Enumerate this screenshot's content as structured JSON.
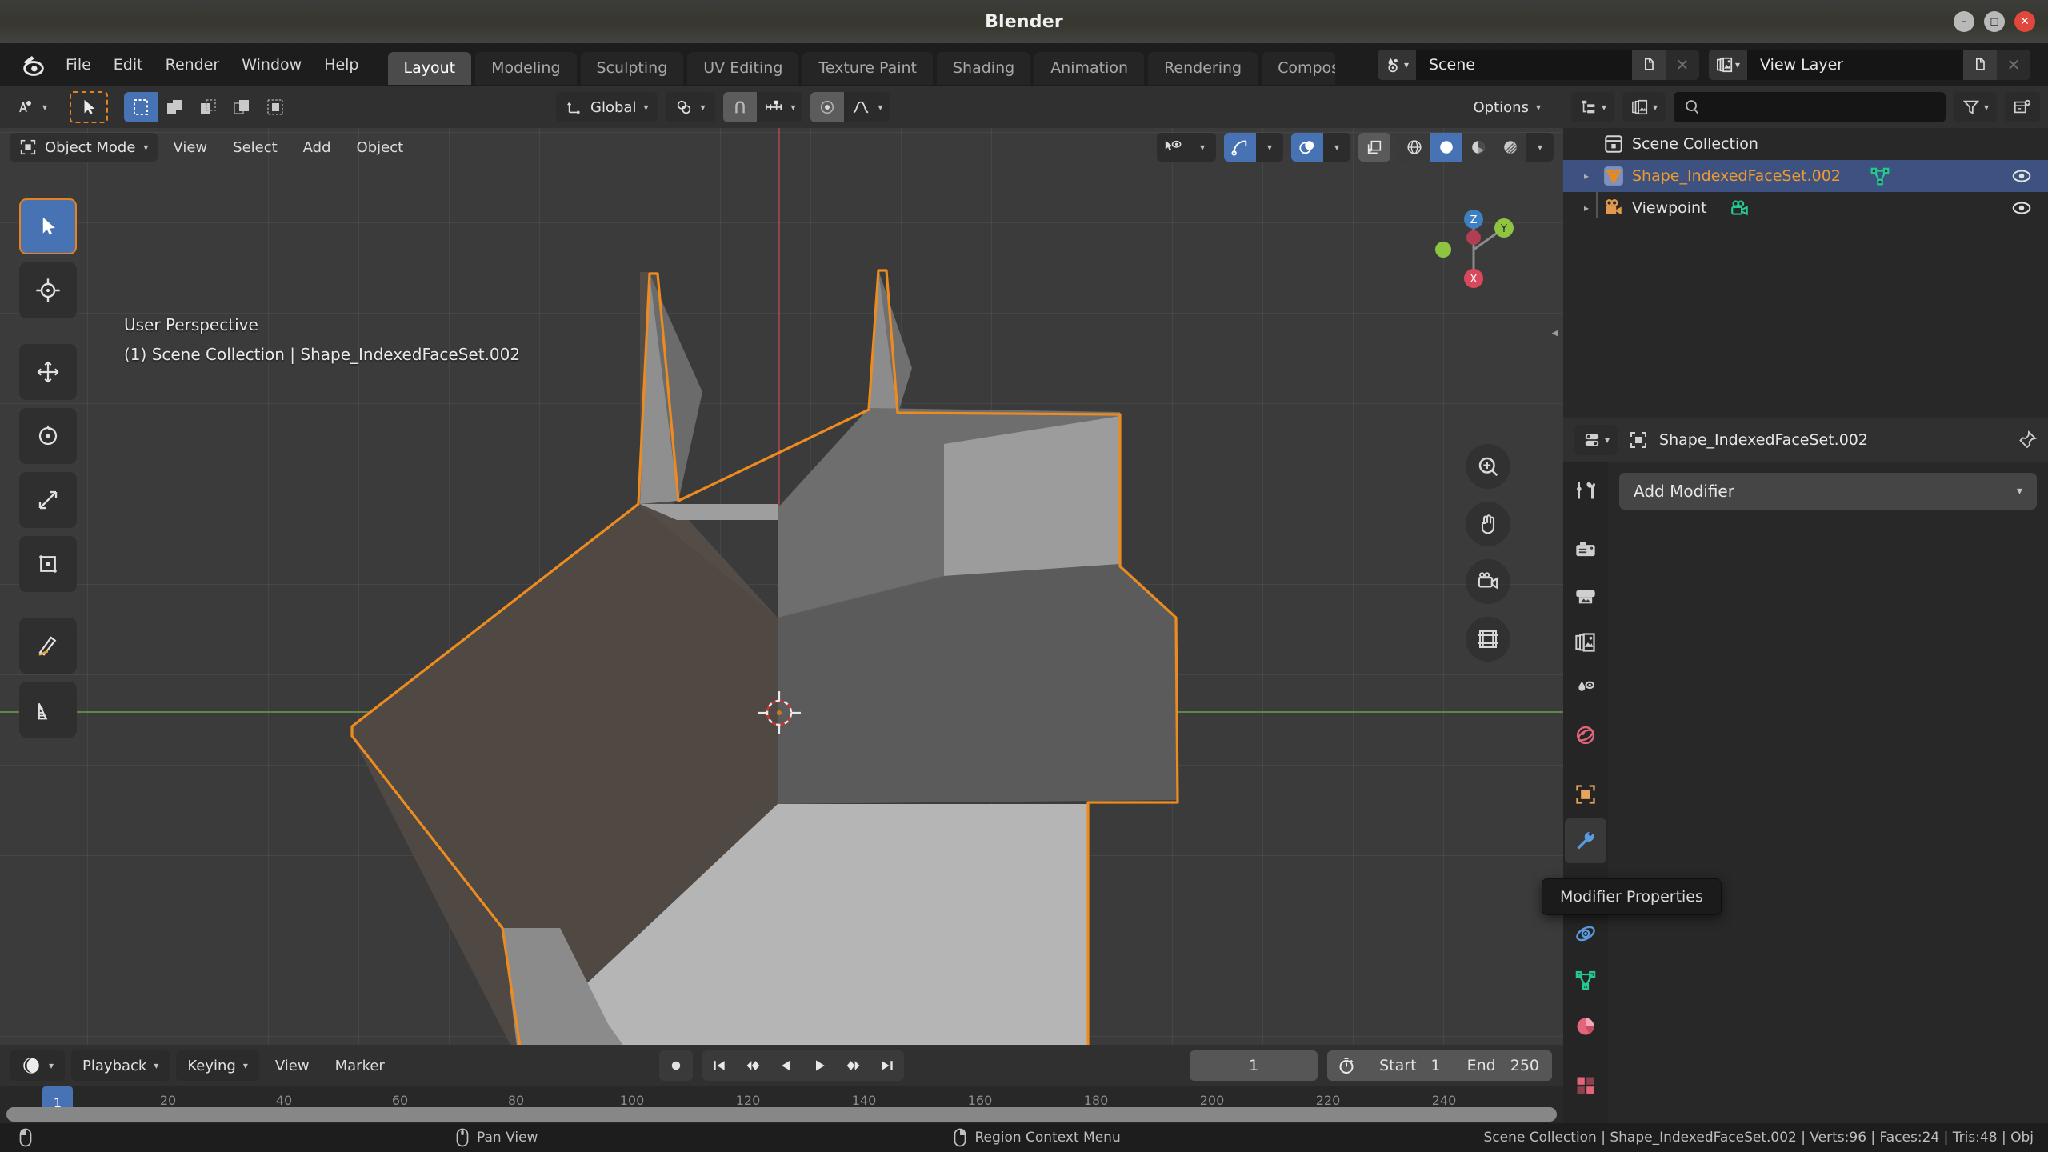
{
  "window": {
    "title": "Blender",
    "controls": {
      "minimize": "minimize-icon",
      "maximize": "maximize-icon",
      "close": "close-icon"
    }
  },
  "topbar": {
    "logo": "blender-logo-icon",
    "menus": [
      "File",
      "Edit",
      "Render",
      "Window",
      "Help"
    ],
    "workspaces": [
      {
        "label": "Layout",
        "active": true
      },
      {
        "label": "Modeling",
        "active": false
      },
      {
        "label": "Sculpting",
        "active": false
      },
      {
        "label": "UV Editing",
        "active": false
      },
      {
        "label": "Texture Paint",
        "active": false
      },
      {
        "label": "Shading",
        "active": false
      },
      {
        "label": "Animation",
        "active": false
      },
      {
        "label": "Rendering",
        "active": false
      },
      {
        "label": "Compos",
        "active": false
      }
    ],
    "scene": {
      "icon": "scene-icon",
      "name": "Scene",
      "new_icon": "duplicate-icon",
      "unlink_icon": "x-icon"
    },
    "view_layer": {
      "icon": "view-layer-icon",
      "name": "View Layer",
      "new_icon": "duplicate-icon",
      "unlink_icon": "x-icon"
    }
  },
  "viewport_toolheader": {
    "editor_type_icon": "editor-type-3dview-icon",
    "cursor_tool": "select-cursor-icon",
    "select_modes": [
      "select-box-icon",
      "select-extend-icon",
      "select-subtract-icon",
      "select-invert-icon",
      "select-intersect-icon"
    ],
    "transform_orientation": {
      "icon": "orientation-icon",
      "value": "Global"
    },
    "pivot_point": {
      "icon": "pivot-icon"
    },
    "snapping": {
      "magnet_icon": "magnet-icon",
      "snap_to_icon": "snap-increment-icon",
      "enabled": false
    },
    "proportional_editing": {
      "icon": "proportional-icon",
      "falloff_icon": "falloff-smooth-icon",
      "enabled": false
    },
    "options_label": "Options"
  },
  "viewport_header": {
    "mode": {
      "icon": "object-mode-icon",
      "label": "Object Mode"
    },
    "menus": [
      "View",
      "Select",
      "Add",
      "Object"
    ],
    "right_controls": {
      "visibility_icon": "object-visibility-icon",
      "gizmo_icon": "gizmo-icon",
      "gizmo_on": true,
      "overlays_icon": "overlays-icon",
      "overlays_on": true,
      "xray_icon": "xray-toggle-icon",
      "shading_modes": [
        {
          "icon": "shading-wireframe-icon",
          "active": false
        },
        {
          "icon": "shading-solid-icon",
          "active": true
        },
        {
          "icon": "shading-material-icon",
          "active": false
        },
        {
          "icon": "shading-rendered-icon",
          "active": false
        }
      ]
    }
  },
  "viewport": {
    "overlay_line1": "User Perspective",
    "overlay_line2": "(1) Scene Collection | Shape_IndexedFaceSet.002",
    "tools": [
      "tweak-tool-icon",
      "cursor-tool-icon",
      "move-tool-icon",
      "rotate-tool-icon",
      "scale-tool-icon",
      "transform-tool-icon",
      "annotate-tool-icon",
      "measure-tool-icon"
    ],
    "nav_buttons": [
      "zoom-icon",
      "pan-hand-icon",
      "camera-view-icon",
      "ortho-persp-toggle-icon"
    ],
    "gizmo_axes": {
      "x": "X",
      "y": "Y",
      "z": "Z"
    },
    "colors": {
      "background": "#3b3b3b",
      "object_outline": "#ec8b20",
      "axis_x_green": "#6ea050",
      "axis_y_red": "#aa4650"
    },
    "object_faces": [
      {
        "name": "face-left-dark",
        "fill": "#4f4843"
      },
      {
        "name": "face-top-mid",
        "fill": "#6e6e6e"
      },
      {
        "name": "face-top-right",
        "fill": "#9b9b9b"
      },
      {
        "name": "face-front-right",
        "fill": "#5b5b5b"
      },
      {
        "name": "face-bottom-right",
        "fill": "#b5b5b5"
      },
      {
        "name": "face-bottom-left",
        "fill": "#8b8b8b"
      }
    ]
  },
  "outliner": {
    "display_mode_icon": "outliner-display-mode-icon",
    "filter_id_icon": "outliner-id-type-icon",
    "search_placeholder": "",
    "search_icon": "search-icon",
    "filter_icon": "filter-icon",
    "new_collection_icon": "new-collection-icon",
    "rows": [
      {
        "name": "Scene Collection",
        "icon": "collection-icon",
        "indent": 0,
        "selected": false,
        "has_disclosure": false,
        "data_icon": null,
        "eye": false,
        "color": "#dcdcdc"
      },
      {
        "name": "Shape_IndexedFaceSet.002",
        "icon": "mesh-object-icon",
        "indent": 1,
        "selected": true,
        "has_disclosure": true,
        "data_icon": "mesh-data-icon",
        "eye": true,
        "color": "#ed9a2e"
      },
      {
        "name": "Viewpoint",
        "icon": "camera-object-icon",
        "indent": 1,
        "selected": false,
        "has_disclosure": true,
        "data_icon": "camera-data-icon",
        "eye": true,
        "color": "#dcdcdc"
      }
    ]
  },
  "properties": {
    "editor_icon": "properties-editor-icon",
    "breadcrumb_icon": "object-icon",
    "breadcrumb": "Shape_IndexedFaceSet.002",
    "pin_icon": "pin-icon",
    "tabs": [
      {
        "name": "tool-tab",
        "icon": "tool-icon",
        "active": false,
        "color": "#cfcfcf"
      },
      {
        "name": "render-tab",
        "icon": "render-camera-icon",
        "active": false,
        "color": "#cfcfcf"
      },
      {
        "name": "output-tab",
        "icon": "printer-output-icon",
        "active": false,
        "color": "#cfcfcf"
      },
      {
        "name": "view-layer-tab",
        "icon": "view-layer-images-icon",
        "active": false,
        "color": "#cfcfcf"
      },
      {
        "name": "scene-tab",
        "icon": "scene-cone-icon",
        "active": false,
        "color": "#cfcfcf"
      },
      {
        "name": "world-tab",
        "icon": "world-globe-icon",
        "active": false,
        "color": "#e2657a"
      },
      {
        "name": "object-tab",
        "icon": "object-square-icon",
        "active": false,
        "color": "#e8a35c"
      },
      {
        "name": "modifier-tab",
        "icon": "wrench-icon",
        "active": true,
        "color": "#5a9ce0"
      },
      {
        "name": "particles-tab",
        "icon": "particles-icon",
        "active": false,
        "color": "#5a9ce0"
      },
      {
        "name": "physics-tab",
        "icon": "physics-orbit-icon",
        "active": false,
        "color": "#5a9ce0"
      },
      {
        "name": "constraints-tab",
        "icon": "constraint-icon",
        "active": false,
        "color": "#5a9ce0"
      },
      {
        "name": "data-tab",
        "icon": "mesh-data-green-icon",
        "active": false,
        "color": "#2fbf8f"
      },
      {
        "name": "material-tab",
        "icon": "material-sphere-icon",
        "active": false,
        "color": "#e2657a"
      },
      {
        "name": "texture-tab",
        "icon": "texture-checker-icon",
        "active": false,
        "color": "#e2657a"
      }
    ],
    "add_modifier_label": "Add Modifier",
    "add_modifier_chevron": "chevron-down-icon"
  },
  "tooltip": {
    "text": "Modifier Properties"
  },
  "timeline": {
    "editor_icon": "timeline-editor-icon",
    "menus_dropdowns": [
      "Playback",
      "Keying"
    ],
    "menus": [
      "View",
      "Marker"
    ],
    "record_icon": "record-keyframe-icon",
    "transport": [
      "jump-start-icon",
      "prev-keyframe-icon",
      "play-reverse-icon",
      "play-icon",
      "next-keyframe-icon",
      "jump-end-icon"
    ],
    "current_frame": "1",
    "stopwatch_icon": "stopwatch-icon",
    "start_label": "Start",
    "start_value": "1",
    "end_label": "End",
    "end_value": "250",
    "ruler_ticks": [
      "20",
      "40",
      "60",
      "80",
      "100",
      "120",
      "140",
      "160",
      "180",
      "200",
      "220",
      "240"
    ],
    "playhead_frame": "1"
  },
  "statusbar": {
    "mouse_icon": "mouse-icon",
    "items": [
      {
        "icon": "mouse-left-icon",
        "label": ""
      },
      {
        "icon": "mouse-middle-icon",
        "label": "Pan View"
      },
      {
        "icon": "mouse-right-icon",
        "label": "Region Context Menu"
      }
    ],
    "scene_stats": "Scene Collection | Shape_IndexedFaceSet.002 | Verts:96 | Faces:24 | Tris:48 | Obj"
  }
}
